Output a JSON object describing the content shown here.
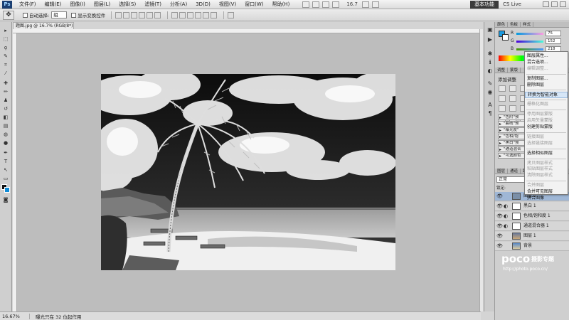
{
  "menubar": {
    "app_logo": "Ps",
    "items": [
      "文件(F)",
      "编辑(E)",
      "图像(I)",
      "图层(L)",
      "选择(S)",
      "滤镜(T)",
      "分析(A)",
      "3D(D)",
      "视图(V)",
      "窗口(W)",
      "帮助(H)"
    ],
    "zoom": "16.7",
    "workspace": "基本功能",
    "cs_live": "CS Live"
  },
  "options": {
    "auto_select_label": "自动选择:",
    "auto_select_value": "组",
    "show_transform_label": "显示变换控件"
  },
  "document": {
    "tab_title": "题图.jpg @ 16.7% (RGB/8*)",
    "zoom_status": "16.67%",
    "status_info": "曝光只在 32 位起作用"
  },
  "color_panel": {
    "tabs": [
      "颜色",
      "色板",
      "样式"
    ],
    "channels": [
      {
        "name": "R",
        "value": "75"
      },
      {
        "name": "G",
        "value": "152"
      },
      {
        "name": "B",
        "value": "218"
      }
    ],
    "foreground": "#1b9be0",
    "background": "#ffffff"
  },
  "adjust_panel": {
    "tabs": [
      "调整",
      "蒙版"
    ],
    "title": "添加调整",
    "presets": [
      "\"色阶\"预",
      "\"曲线\"预",
      "\"曝光度\"",
      "\"色相/饱",
      "\"黑白\"预",
      "\"通道混合",
      "\"可选颜色"
    ]
  },
  "context_menu": {
    "items": [
      {
        "label": "图层属性...",
        "enabled": true
      },
      {
        "label": "混合选项...",
        "enabled": true
      },
      {
        "label": "编辑调整...",
        "enabled": false
      },
      {
        "sep": true
      },
      {
        "label": "复制图层...",
        "enabled": true
      },
      {
        "label": "删除图层",
        "enabled": true
      },
      {
        "sep": true
      },
      {
        "label": "转换为智能对象",
        "enabled": true,
        "highlighted": true
      },
      {
        "sep": true
      },
      {
        "label": "栅格化图层",
        "enabled": false
      },
      {
        "sep": true
      },
      {
        "label": "停用图层蒙版",
        "enabled": false
      },
      {
        "label": "启用矢量蒙版",
        "enabled": false
      },
      {
        "label": "创建剪贴蒙版",
        "enabled": true
      },
      {
        "sep": true
      },
      {
        "label": "链接图层",
        "enabled": false
      },
      {
        "label": "选择链接图层",
        "enabled": false
      },
      {
        "sep": true
      },
      {
        "label": "选择相似图层",
        "enabled": true
      },
      {
        "sep": true
      },
      {
        "label": "拷贝图层样式",
        "enabled": false
      },
      {
        "label": "粘贴图层样式",
        "enabled": false
      },
      {
        "label": "清除图层样式",
        "enabled": false
      },
      {
        "sep": true
      },
      {
        "label": "合并图层",
        "enabled": false
      },
      {
        "label": "合并可见图层",
        "enabled": true
      },
      {
        "label": "拼合图像",
        "enabled": true
      }
    ]
  },
  "layers_panel": {
    "tabs": [
      "图层",
      "通道",
      "路径"
    ],
    "blend_mode": "正常",
    "lock_label": "锁定:",
    "layers": [
      {
        "name": "图层 2",
        "type": "pixel",
        "selected": true
      },
      {
        "name": "黑白 1",
        "type": "adjust"
      },
      {
        "name": "色相/饱和度 1",
        "type": "adjust"
      },
      {
        "name": "通道混合器 1",
        "type": "adjust"
      },
      {
        "name": "图层 1",
        "type": "pixel"
      },
      {
        "name": "背景",
        "type": "pixel"
      }
    ]
  },
  "watermark": {
    "logo": "poco",
    "tag": "摄影专题",
    "url": "http://photo.poco.cn/"
  }
}
